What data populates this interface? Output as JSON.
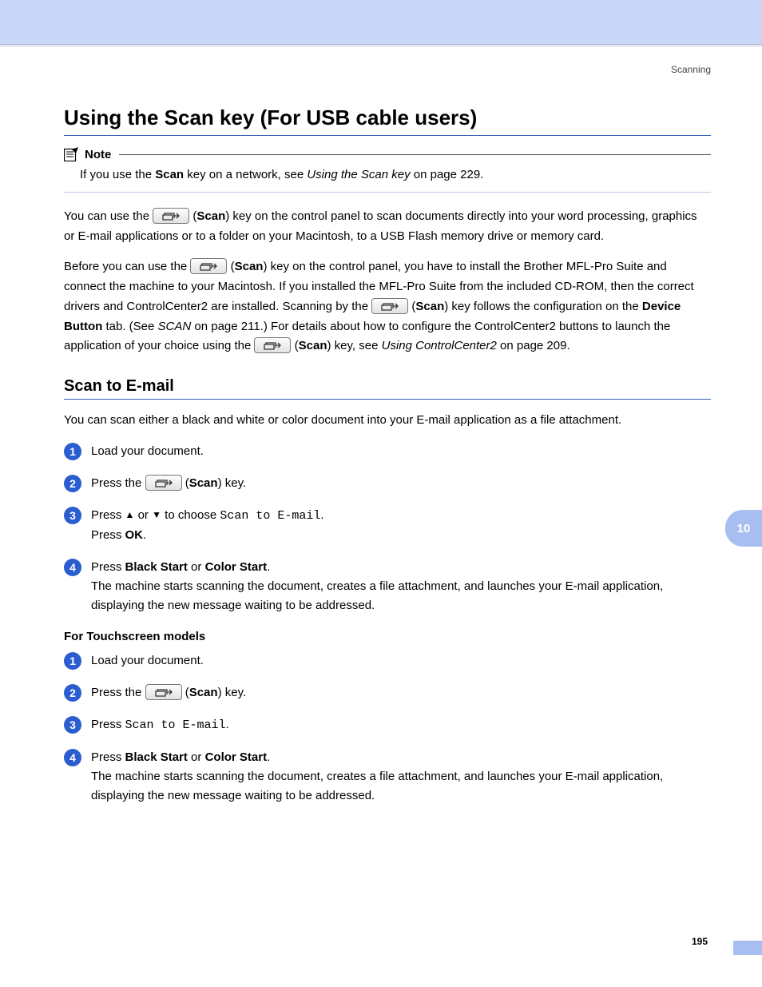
{
  "runningHead": "Scanning",
  "title": "Using the Scan key (For USB cable users)",
  "note": {
    "label": "Note",
    "body": {
      "t1": "If you use the ",
      "b1": "Scan",
      "t2": " key on a network, see ",
      "i1": "Using the Scan key",
      "t3": " on page 229."
    }
  },
  "para1": {
    "t1": "You can use the ",
    "t2": " (",
    "b1": "Scan",
    "t3": ") key on the control panel to scan documents directly into your word processing, graphics or E-mail applications or to a folder on your Macintosh, to a USB Flash memory drive or memory card."
  },
  "para2": {
    "t1": "Before you can use the ",
    "t2": " (",
    "b1": "Scan",
    "t3": ") key on the control panel, you have to install the Brother MFL-Pro Suite and connect the machine to your Macintosh. If you installed the MFL-Pro Suite from the included CD-ROM, then the correct drivers and ControlCenter2 are installed. Scanning by the ",
    "t4": " (",
    "b2": "Scan",
    "t5": ") key follows the configuration on the ",
    "b3": "Device Button",
    "t6": " tab. (See ",
    "i1": "SCAN",
    "t7": " on page 211.) For details about how to configure the ControlCenter2 buttons to launch the application of your choice using the ",
    "t8": " (",
    "b4": "Scan",
    "t9": ") key, see ",
    "i2": "Using ControlCenter2",
    "t10": " on page 209."
  },
  "section2": {
    "title": "Scan to E-mail",
    "intro": "You can scan either a black and white or color document into your E-mail application as a file attachment."
  },
  "stepsA": {
    "s1": "Load your document.",
    "s2": {
      "t1": "Press the ",
      "t2": " (",
      "b1": "Scan",
      "t3": ") key."
    },
    "s3": {
      "t1": "Press ",
      "a1": "▲",
      "t2": " or ",
      "a2": "▼",
      "t3": " to choose ",
      "m1": "Scan to E-mail",
      "t4": ".",
      "t5": "Press ",
      "b1": "OK",
      "t6": "."
    },
    "s4": {
      "t1": "Press ",
      "b1": "Black Start",
      "t2": " or ",
      "b2": "Color Start",
      "t3": ".",
      "t4": "The machine starts scanning the document, creates a file attachment, and launches your E-mail application, displaying the new message waiting to be addressed."
    }
  },
  "touchHead": "For Touchscreen models",
  "stepsB": {
    "s1": "Load your document.",
    "s2": {
      "t1": "Press the ",
      "t2": " (",
      "b1": "Scan",
      "t3": ") key."
    },
    "s3": {
      "t1": "Press ",
      "m1": "Scan to E-mail",
      "t2": "."
    },
    "s4": {
      "t1": "Press ",
      "b1": "Black Start",
      "t2": " or ",
      "b2": "Color Start",
      "t3": ".",
      "t4": "The machine starts scanning the document, creates a file attachment, and launches your E-mail application, displaying the new message waiting to be addressed."
    }
  },
  "sideTab": "10",
  "pageNum": "195"
}
